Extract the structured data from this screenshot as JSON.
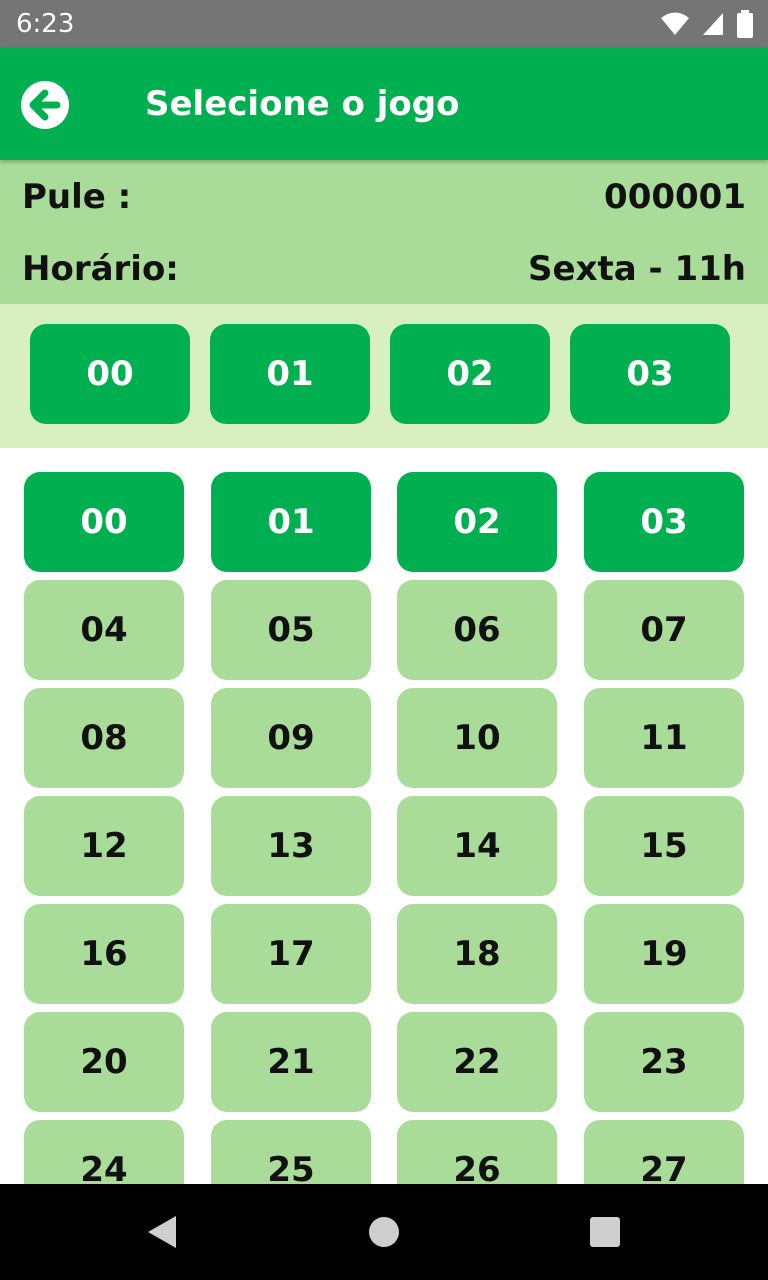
{
  "status_bar": {
    "time": "6:23",
    "icons": [
      "wifi-icon",
      "signal-icon",
      "battery-icon"
    ]
  },
  "app_bar": {
    "title": "Selecione o jogo",
    "back_icon": "arrow-left-icon"
  },
  "info": {
    "pule_label": "Pule :",
    "pule_value": "000001",
    "horario_label": "Horário:",
    "horario_value": "Sexta - 11h"
  },
  "selected": [
    "00",
    "01",
    "02",
    "03"
  ],
  "numbers": [
    {
      "label": "00",
      "selected": true
    },
    {
      "label": "01",
      "selected": true
    },
    {
      "label": "02",
      "selected": true
    },
    {
      "label": "03",
      "selected": true
    },
    {
      "label": "04",
      "selected": false
    },
    {
      "label": "05",
      "selected": false
    },
    {
      "label": "06",
      "selected": false
    },
    {
      "label": "07",
      "selected": false
    },
    {
      "label": "08",
      "selected": false
    },
    {
      "label": "09",
      "selected": false
    },
    {
      "label": "10",
      "selected": false
    },
    {
      "label": "11",
      "selected": false
    },
    {
      "label": "12",
      "selected": false
    },
    {
      "label": "13",
      "selected": false
    },
    {
      "label": "14",
      "selected": false
    },
    {
      "label": "15",
      "selected": false
    },
    {
      "label": "16",
      "selected": false
    },
    {
      "label": "17",
      "selected": false
    },
    {
      "label": "18",
      "selected": false
    },
    {
      "label": "19",
      "selected": false
    },
    {
      "label": "20",
      "selected": false
    },
    {
      "label": "21",
      "selected": false
    },
    {
      "label": "22",
      "selected": false
    },
    {
      "label": "23",
      "selected": false
    },
    {
      "label": "24",
      "selected": false
    },
    {
      "label": "25",
      "selected": false
    },
    {
      "label": "26",
      "selected": false
    },
    {
      "label": "27",
      "selected": false
    }
  ],
  "colors": {
    "primary": "#00b050",
    "light": "#a8dc98",
    "lighter": "#d8f0c0",
    "status": "#757575"
  },
  "nav_bar": {
    "icons": [
      "back-triangle-icon",
      "home-circle-icon",
      "recents-square-icon"
    ]
  }
}
